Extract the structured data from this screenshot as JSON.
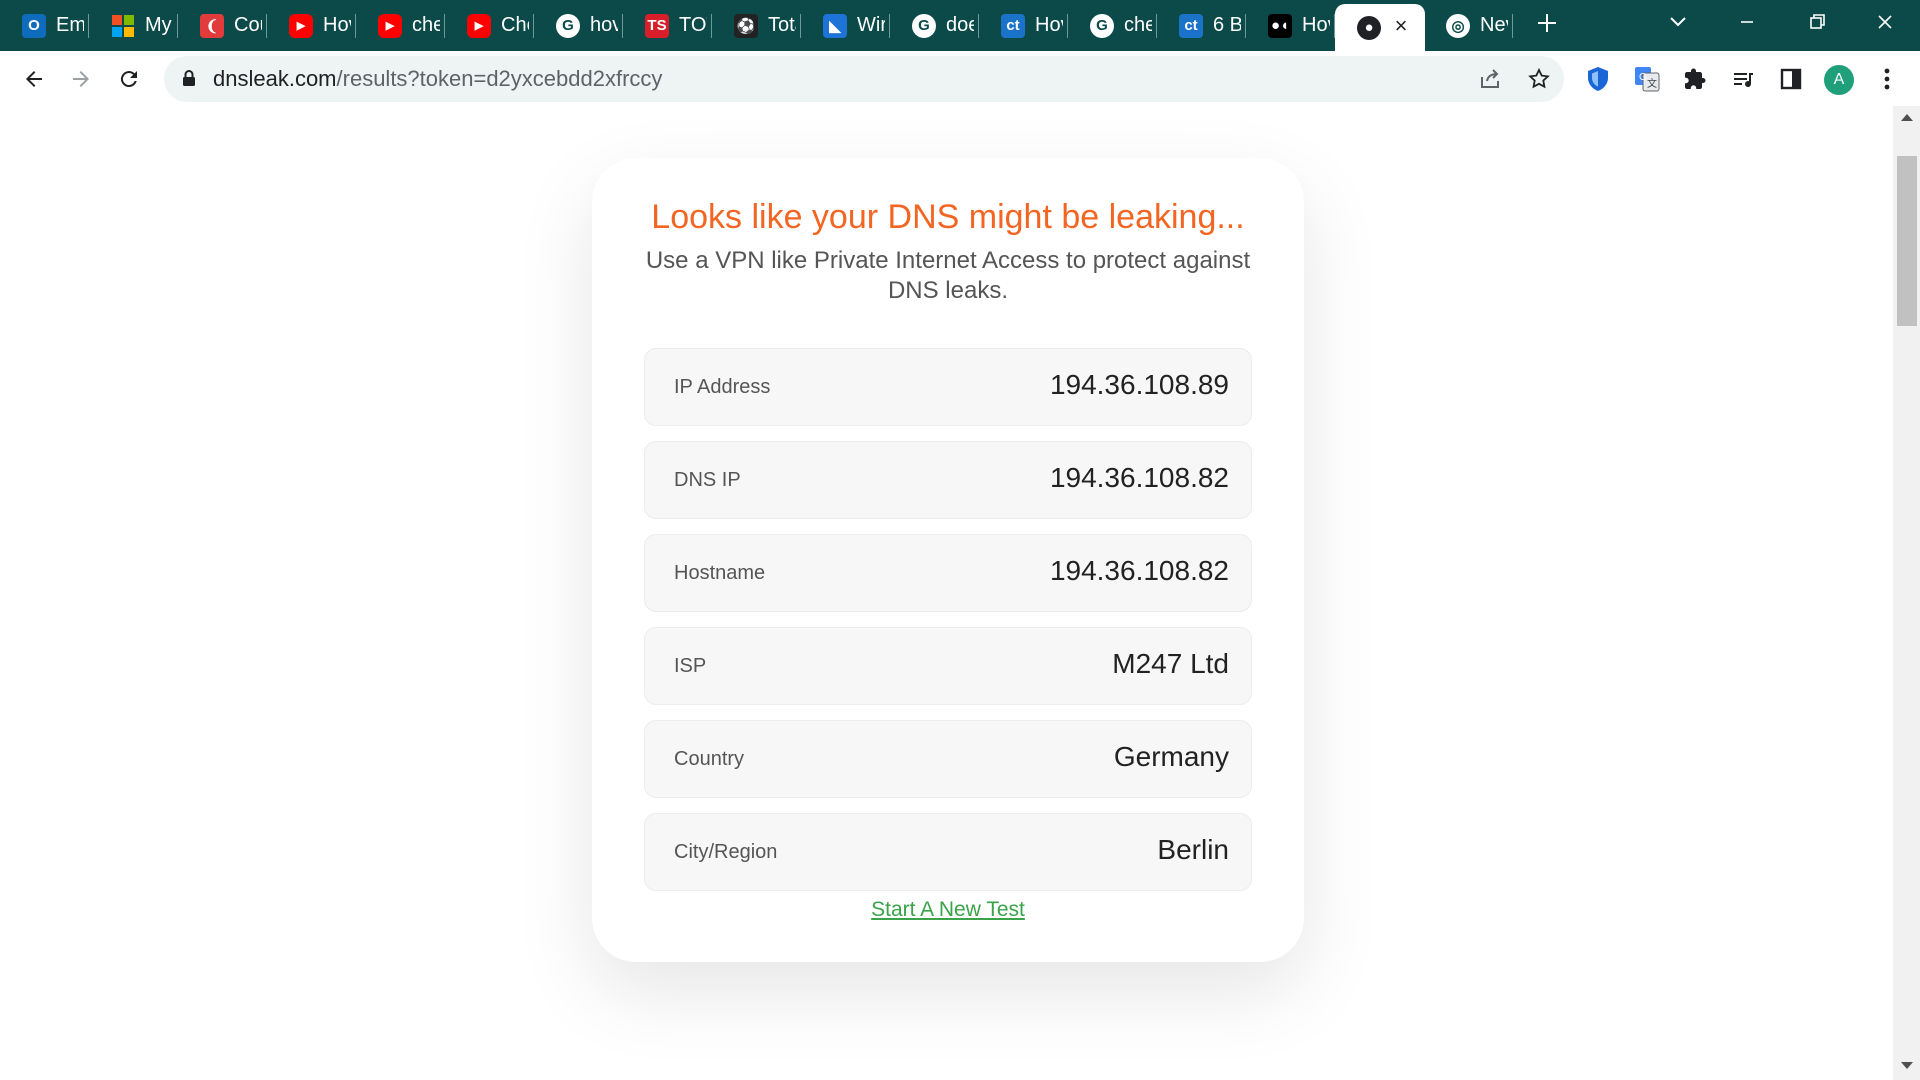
{
  "browser": {
    "tabs": [
      {
        "name": "outlook",
        "label": "Ema",
        "icon": "outlook-icon",
        "color": "#0f6cbd",
        "glyph": "O"
      },
      {
        "name": "microsoft",
        "label": "My",
        "icon": "microsoft-icon",
        "color": "",
        "glyph": ""
      },
      {
        "name": "coursera",
        "label": "Cou",
        "icon": "red-ribbon-icon",
        "color": "#e23b3b",
        "glyph": "❨"
      },
      {
        "name": "youtube-1",
        "label": "Hov",
        "icon": "youtube-icon",
        "color": "#ff0000",
        "glyph": "▶"
      },
      {
        "name": "youtube-2",
        "label": "che",
        "icon": "youtube-icon",
        "color": "#ff0000",
        "glyph": "▶"
      },
      {
        "name": "youtube-3",
        "label": "Che",
        "icon": "youtube-icon",
        "color": "#ff0000",
        "glyph": "▶"
      },
      {
        "name": "google-1",
        "label": "hov",
        "icon": "google-icon",
        "color": "#ffffff",
        "glyph": "G"
      },
      {
        "name": "ts",
        "label": "TOT",
        "icon": "ts-icon",
        "color": "#d81e28",
        "glyph": "TS"
      },
      {
        "name": "soccer",
        "label": "Tota",
        "icon": "soccer-ball-icon",
        "color": "#222222",
        "glyph": "⚽"
      },
      {
        "name": "wing",
        "label": "Wir",
        "icon": "wing-icon",
        "color": "#1e73d8",
        "glyph": "◣"
      },
      {
        "name": "google-2",
        "label": "doe",
        "icon": "google-icon",
        "color": "#ffffff",
        "glyph": "G"
      },
      {
        "name": "ct-1",
        "label": "Hov",
        "icon": "ct-icon",
        "color": "#1a73c8",
        "glyph": "ct"
      },
      {
        "name": "google-3",
        "label": "che",
        "icon": "google-icon",
        "color": "#ffffff",
        "glyph": "G"
      },
      {
        "name": "ct-2",
        "label": "6 B",
        "icon": "ct-icon",
        "color": "#1a73c8",
        "glyph": "ct"
      },
      {
        "name": "medium",
        "label": "Hov",
        "icon": "medium-icon",
        "color": "#000000",
        "glyph": "●◖"
      },
      {
        "name": "dnsleak",
        "label": "",
        "icon": "globe-icon",
        "color": "#ffffff",
        "glyph": "●",
        "active": true
      },
      {
        "name": "chrome-newtab",
        "label": "Nev",
        "icon": "chrome-icon",
        "color": "#ffffff",
        "glyph": "◎"
      }
    ],
    "url": {
      "host": "dnsleak.com",
      "path": "/results?token=d2yxcebdd2xfrccy"
    },
    "avatar_initial": "A",
    "accent_color": "#0c4a4a"
  },
  "page": {
    "headline": "Looks like your DNS might be leaking...",
    "subline": "Use a VPN like Private Internet Access to protect against DNS leaks.",
    "rows": [
      {
        "key": "IP Address",
        "value": "194.36.108.89"
      },
      {
        "key": "DNS IP",
        "value": "194.36.108.82"
      },
      {
        "key": "Hostname",
        "value": "194.36.108.82"
      },
      {
        "key": "ISP",
        "value": "M247 Ltd"
      },
      {
        "key": "Country",
        "value": "Germany"
      },
      {
        "key": "City/Region",
        "value": "Berlin"
      }
    ],
    "new_test_link": "Start A New Test",
    "headline_color": "#f26522",
    "link_color": "#3aa34a"
  }
}
